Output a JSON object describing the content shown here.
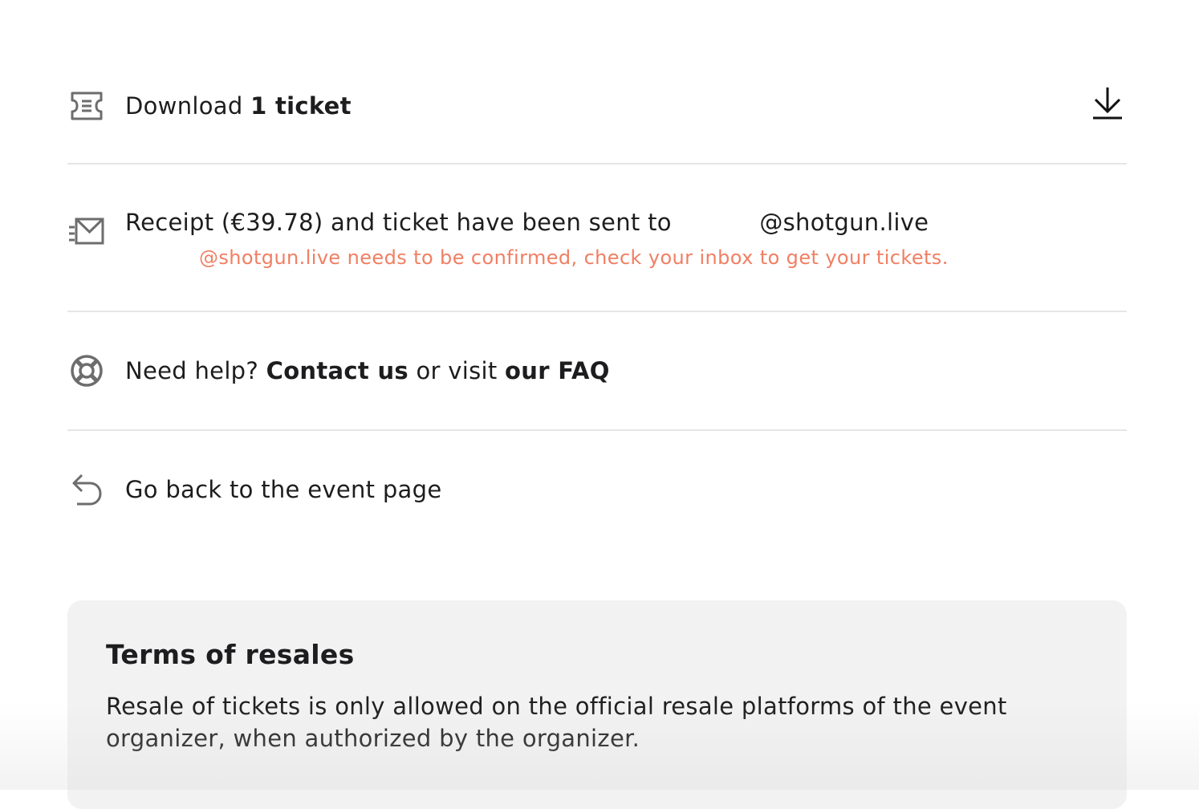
{
  "download": {
    "prefix": "Download ",
    "count": "1 ticket",
    "icon": "download-icon"
  },
  "receipt": {
    "text_before": "Receipt (€39.78) and ticket have been sent to ",
    "email_domain": "@shotgun.live",
    "warning": "@shotgun.live needs to be confirmed, check your inbox to get your tickets."
  },
  "help": {
    "prefix": "Need help? ",
    "contact": "Contact us",
    "middle": " or visit ",
    "faq": "our FAQ"
  },
  "back": {
    "label": "Go back to the event page"
  },
  "terms": {
    "title": "Terms of resales",
    "body": "Resale of tickets is only allowed on the official resale platforms of the event organizer, when authorized by the organizer."
  },
  "colors": {
    "warning": "#f07f63",
    "divider": "#e6e6e6",
    "card_bg": "#f2f2f2"
  }
}
